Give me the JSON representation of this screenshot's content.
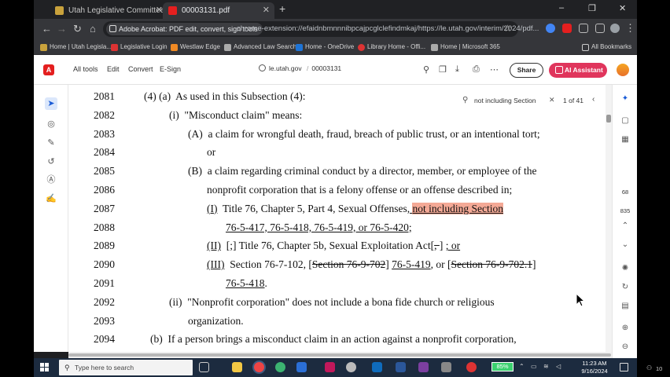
{
  "browser": {
    "tabs": [
      {
        "title": "Utah Legislative Committee Inf",
        "active": false
      },
      {
        "title": "00003131.pdf",
        "active": true
      }
    ],
    "new_tab": "+",
    "window_controls": {
      "minimize": "–",
      "maximize": "❐",
      "close": "✕"
    },
    "extension_chip": "Adobe Acrobat: PDF edit, convert, sign tools",
    "url": "chrome-extension://efaidnbmnnnibpcajpcglclefindmkaj/https://le.utah.gov/interim/2024/pdf...",
    "bookmarks": [
      "Home | Utah Legisla...",
      "Legislative Login",
      "Westlaw Edge",
      "Advanced Law Search",
      "Home - OneDrive",
      "Library Home - Offi...",
      "Home | Microsoft 365"
    ],
    "all_bookmarks": "All Bookmarks"
  },
  "acrobat": {
    "menu": [
      "All tools",
      "Edit",
      "Convert",
      "E-Sign"
    ],
    "domain": "le.utah.gov",
    "filename": "00003131",
    "share_label": "Share",
    "ai_label": "AI Assistant"
  },
  "find": {
    "query": "not including Section",
    "count": "1 of 41"
  },
  "document": {
    "lines": [
      {
        "num": "2081",
        "segments": [
          {
            "t": "(4) (a)  As used in this Subsection (4):"
          }
        ],
        "indent": 0
      },
      {
        "num": "2082",
        "segments": [
          {
            "t": "(i)  \"Misconduct claim\" means:"
          }
        ],
        "indent": 1
      },
      {
        "num": "2083",
        "segments": [
          {
            "t": "(A)  a claim for wrongful death, fraud, breach of public trust, or an intentional tort;"
          }
        ],
        "indent": 2
      },
      {
        "num": "2084",
        "segments": [
          {
            "t": "or"
          }
        ],
        "indent": 3
      },
      {
        "num": "2085",
        "segments": [
          {
            "t": "(B)  a claim regarding criminal conduct by a director, member, or employee of the"
          }
        ],
        "indent": 2
      },
      {
        "num": "2086",
        "segments": [
          {
            "t": "nonprofit corporation that is a felony offense or an offense described in;"
          }
        ],
        "indent": 3
      },
      {
        "num": "2087",
        "segments": [
          {
            "t": "(I)",
            "u": true
          },
          {
            "t": "  Title 76, Chapter 5, Part 4, Sexual Offenses"
          },
          {
            "t": ", ",
            "u": true
          },
          {
            "t": "not including Section",
            "u": true,
            "hl": true
          }
        ],
        "indent": 4
      },
      {
        "num": "2088",
        "segments": [
          {
            "t": "76-5-417, 76-5-418, 76-5-419, or 76-5-420;",
            "u": true
          }
        ],
        "indent": 5
      },
      {
        "num": "2089",
        "segments": [
          {
            "t": "(II)",
            "u": true
          },
          {
            "t": "  [;] Title 76, Chapter 5b, Sexual Exploitation Act["
          },
          {
            "t": ", ",
            "s": true
          },
          {
            "t": "] "
          },
          {
            "t": "; or",
            "u": true
          }
        ],
        "indent": 4
      },
      {
        "num": "2090",
        "segments": [
          {
            "t": "(III)",
            "u": true
          },
          {
            "t": "  Section 76-7-102, ["
          },
          {
            "t": "Section 76-9-702",
            "s": true
          },
          {
            "t": "] "
          },
          {
            "t": "76-5-419",
            "u": true
          },
          {
            "t": ", or ["
          },
          {
            "t": "Section 76-9-702.1",
            "s": true
          },
          {
            "t": "]"
          }
        ],
        "indent": 4
      },
      {
        "num": "2091",
        "segments": [
          {
            "t": "76-5-418",
            "u": true
          },
          {
            "t": "."
          }
        ],
        "indent": 5
      },
      {
        "num": "2092",
        "segments": [
          {
            "t": "(ii)  \"Nonprofit corporation\" does not include a bona fide church or religious"
          }
        ],
        "indent": 1
      },
      {
        "num": "2093",
        "segments": [
          {
            "t": "organization."
          }
        ],
        "indent": 6
      },
      {
        "num": "2094",
        "segments": [
          {
            "t": "(b)  If a person brings a misconduct claim in an action against a nonprofit corporation,"
          }
        ],
        "indent": 7
      }
    ]
  },
  "right_panel": {
    "page_number": "68",
    "page_total": "835"
  },
  "taskbar": {
    "search_placeholder": "Type here to search",
    "battery": "85%",
    "time": "11:23 AM",
    "date": "9/16/2024",
    "people_count": "10"
  },
  "colors": {
    "highlight": "#f4a996",
    "acrobat_red": "#e41f1f",
    "ai_button": "#e0355c",
    "taskbar": "#1c2b3f"
  }
}
